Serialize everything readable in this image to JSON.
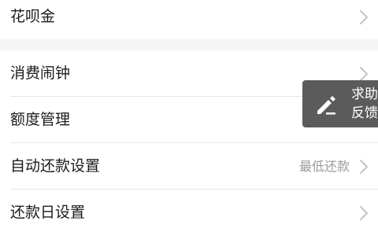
{
  "top_group": {
    "items": [
      {
        "label": "花呗金"
      }
    ]
  },
  "settings": {
    "items": [
      {
        "label": "消费闹钟",
        "value": ""
      },
      {
        "label": "额度管理",
        "value": ""
      },
      {
        "label": "自动还款设置",
        "value": "最低还款"
      },
      {
        "label": "还款日设置",
        "value": ""
      }
    ]
  },
  "help_button": {
    "line1": "求助",
    "line2": "反馈",
    "icon": "edit-icon"
  },
  "colors": {
    "background": "#f5f5f5",
    "row_background": "#ffffff",
    "label_text": "#1c1c1c",
    "value_text": "#9a9a9a",
    "chevron": "#c4c4c4",
    "help_bg": "#5b5b5b"
  }
}
